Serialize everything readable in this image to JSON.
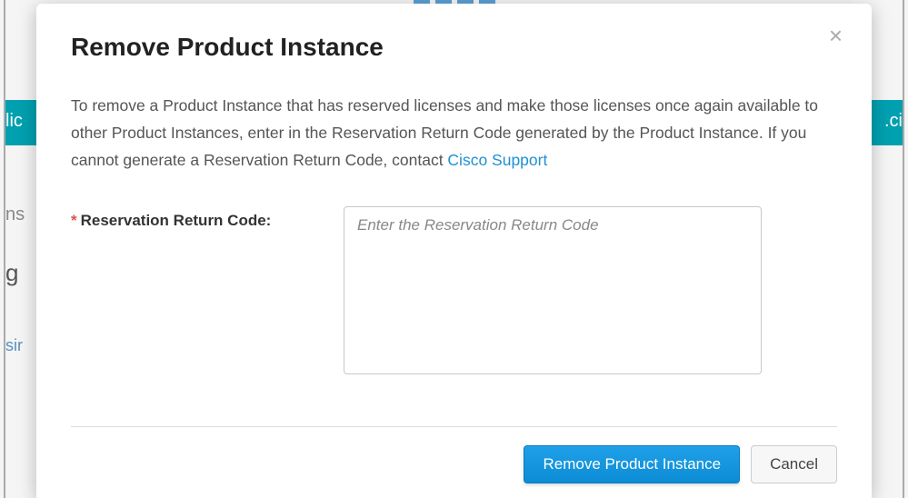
{
  "modal": {
    "title": "Remove Product Instance",
    "description_pre": "To remove a Product Instance that has reserved licenses and make those licenses once again available to other Product Instances, enter in the Reservation Return Code generated by the Product Instance. If you cannot generate a Reservation Return Code, contact ",
    "support_link_text": "Cisco Support",
    "form": {
      "required_mark": "*",
      "label": "Reservation Return Code:",
      "placeholder": "Enter the Reservation Return Code"
    },
    "buttons": {
      "primary": "Remove Product Instance",
      "cancel": "Cancel"
    },
    "close_glyph": "×"
  },
  "background": {
    "fragments": {
      "lic": "lic",
      "ci": ".ci",
      "ns": "ns",
      "g": "g",
      "sir": "sir"
    }
  }
}
